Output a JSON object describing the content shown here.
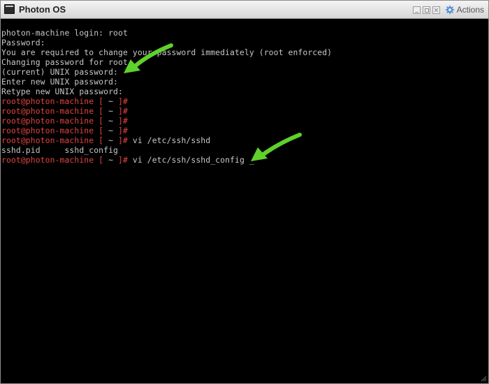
{
  "window": {
    "title": "Photon OS",
    "actions_label": "Actions",
    "icons": {
      "app": "terminal-icon",
      "minimize": "minimize-icon",
      "restore": "restore-icon",
      "close": "close-icon",
      "actions": "gear-icon"
    }
  },
  "terminal": {
    "colors": {
      "background": "#000000",
      "text": "#c7c7c7",
      "prompt": "#e0453f",
      "annotation_arrow": "#5ed12b"
    },
    "lines": [
      {
        "text": "photon-machine login: root"
      },
      {
        "text": "Password:"
      },
      {
        "text": "You are required to change your password immediately (root enforced)"
      },
      {
        "text": "Changing password for root."
      },
      {
        "text": "(current) UNIX password:"
      },
      {
        "text": "Enter new UNIX password:"
      },
      {
        "text": "Retype new UNIX password:"
      }
    ],
    "prompt": {
      "user_host": "root@photon-machine",
      "open": " [ ",
      "path": "~",
      "close": " ]",
      "hash": "#"
    },
    "prompt_lines": [
      {
        "cmd": ""
      },
      {
        "cmd": ""
      },
      {
        "cmd": ""
      },
      {
        "cmd": ""
      },
      {
        "cmd": " vi /etc/ssh/sshd"
      }
    ],
    "completion_line": "sshd.pid     sshd_config",
    "final_prompt_cmd": " vi /etc/ssh/sshd_config ",
    "cursor": "_"
  }
}
